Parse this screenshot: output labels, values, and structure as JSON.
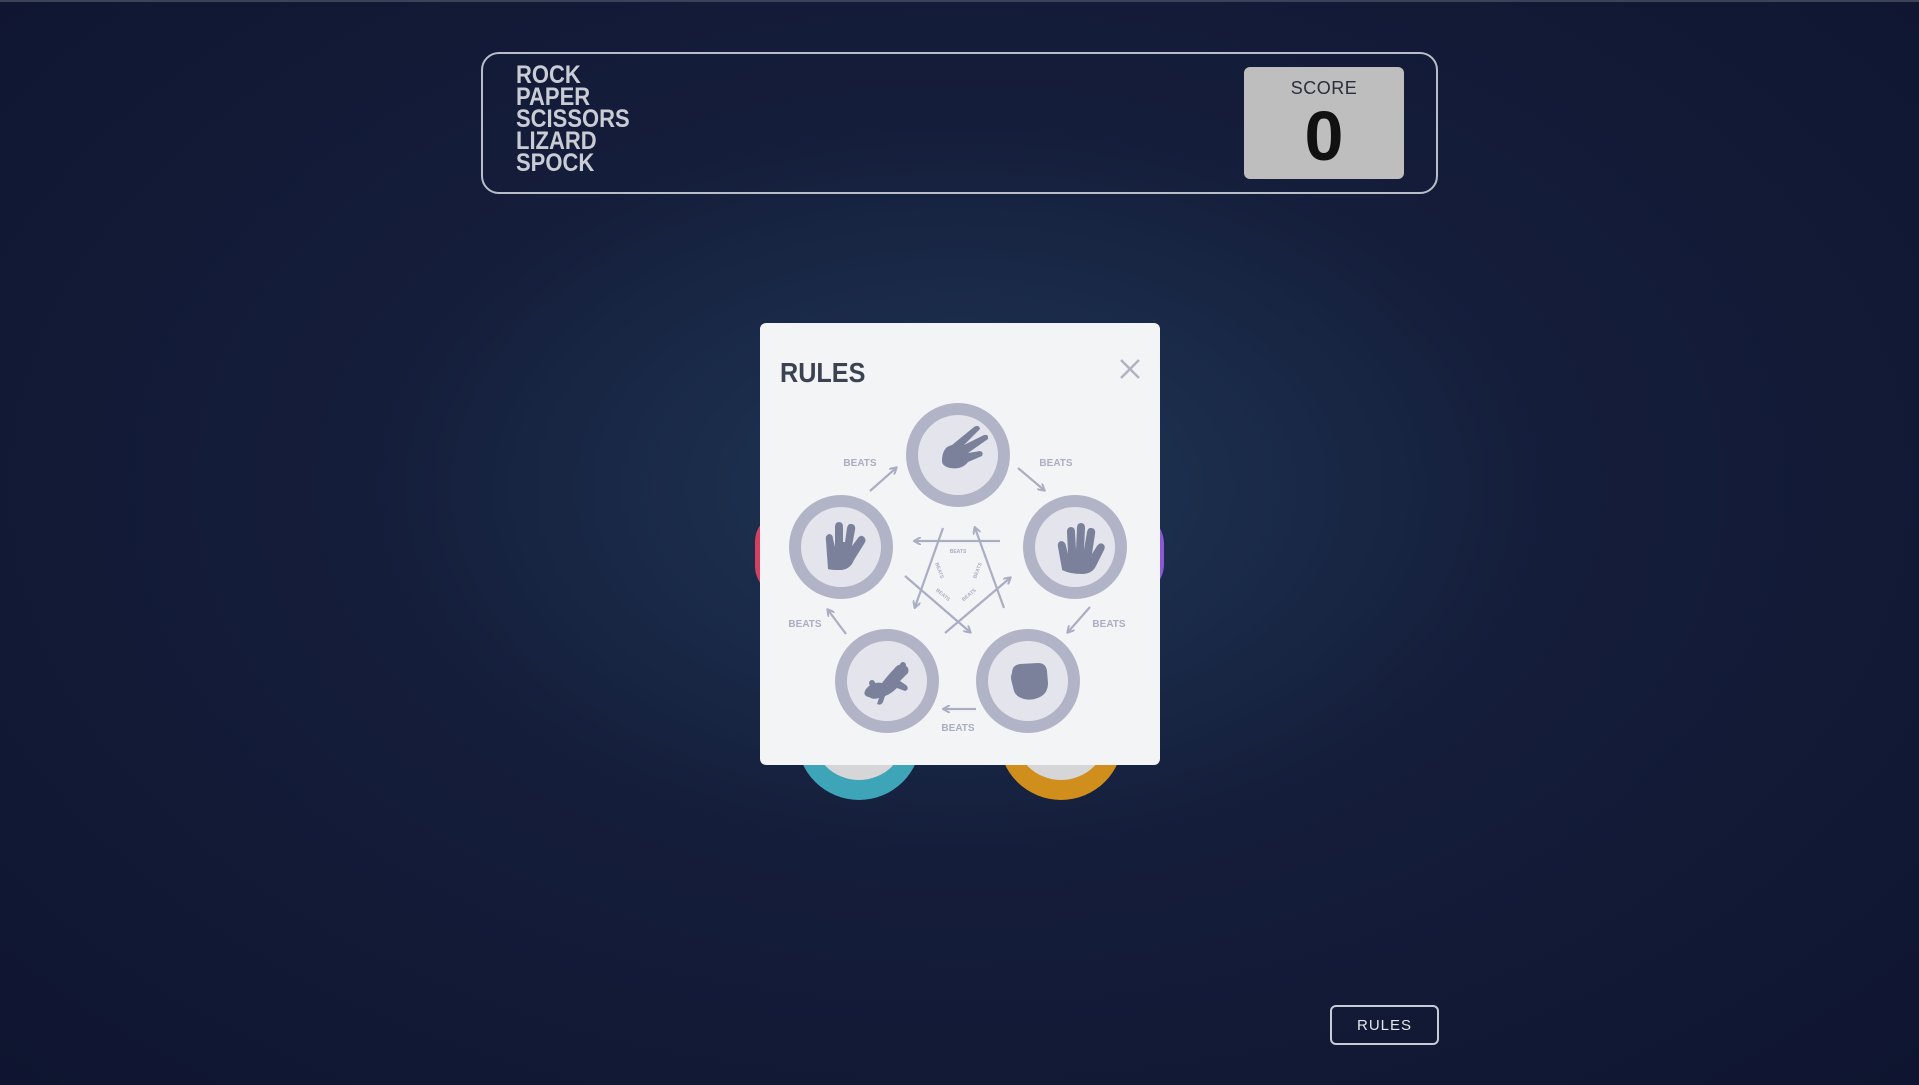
{
  "header": {
    "title_lines": [
      "ROCK",
      "PAPER",
      "SCISSORS",
      "LIZARD",
      "SPOCK"
    ],
    "score_label": "SCORE",
    "score_value": "0"
  },
  "modal": {
    "title": "RULES",
    "close_icon": "close-icon",
    "beats_label": "BEATS",
    "diagram": {
      "nodes": [
        "scissors",
        "paper",
        "rock",
        "lizard",
        "spock"
      ],
      "node_icons": [
        "scissors-icon",
        "paper-icon",
        "rock-icon",
        "lizard-icon",
        "spock-icon"
      ]
    }
  },
  "footer": {
    "rules_button": "RULES"
  },
  "colors": {
    "background": "#141d3a",
    "modal_bg": "#f3f4f6",
    "diagram_gray": "#a9aec2",
    "icon_dark": "#7b819a",
    "score_bg": "#bebebe"
  }
}
